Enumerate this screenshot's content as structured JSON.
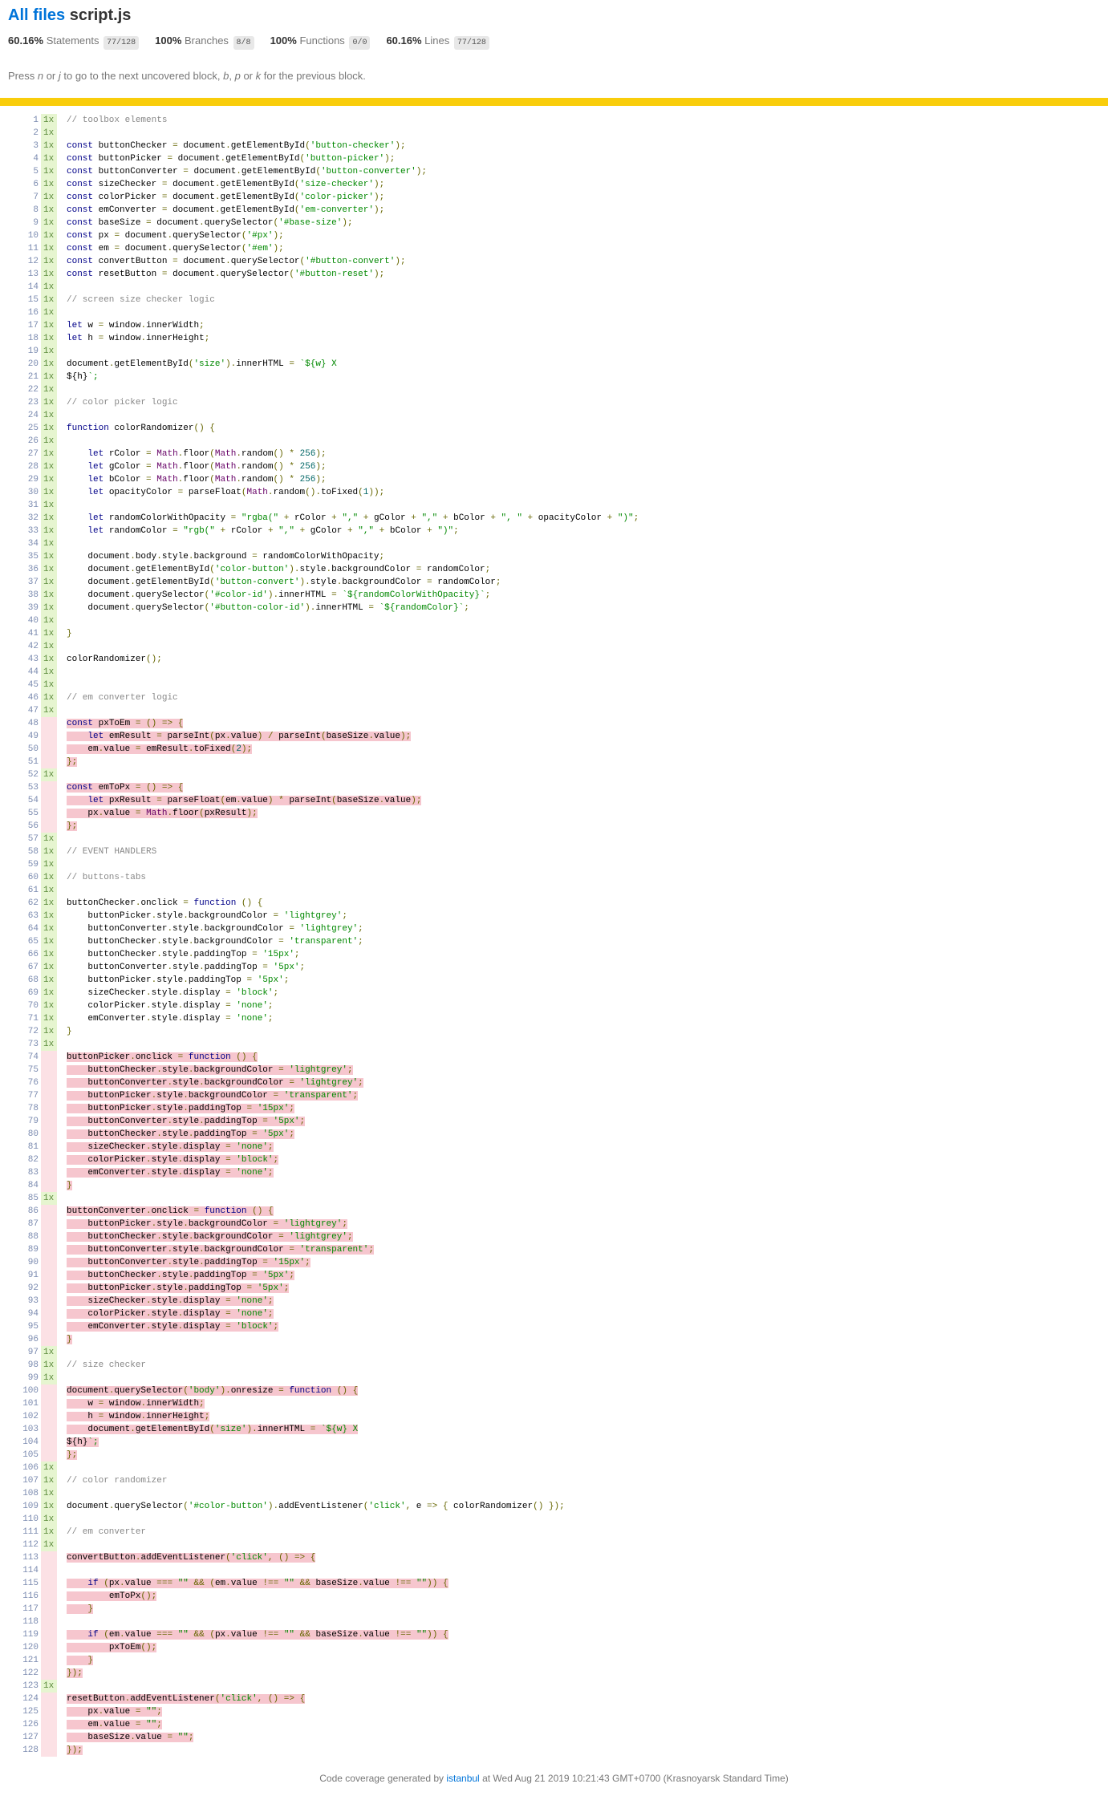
{
  "header": {
    "breadcrumb_link": "All files",
    "file_name": "script.js"
  },
  "summary": [
    {
      "pct": "60.16%",
      "label": "Statements",
      "fraction": "77/128"
    },
    {
      "pct": "100%",
      "label": "Branches",
      "fraction": "8/8"
    },
    {
      "pct": "100%",
      "label": "Functions",
      "fraction": "0/0"
    },
    {
      "pct": "60.16%",
      "label": "Lines",
      "fraction": "77/128"
    }
  ],
  "hint": {
    "p1": "Press ",
    "k1": "n",
    "p2": " or ",
    "k2": "j",
    "p3": " to go to the next uncovered block, ",
    "k3": "b",
    "p4": ", ",
    "k4": "p",
    "p5": " or ",
    "k5": "k",
    "p6": " for the previous block."
  },
  "status_color": "#F9CD0B",
  "colors": {
    "covered": "#E6F5D0",
    "uncovered_gutter": "#FCE1E5",
    "uncovered_code": "#F6C6CE",
    "link": "#0074D9"
  },
  "lines": [
    {
      "hits": "1x",
      "code": "// toolbox elements",
      "covered": true
    },
    {
      "hits": "1x",
      "code": "",
      "covered": true
    },
    {
      "hits": "1x",
      "code": "const buttonChecker = document.getElementById('button-checker');",
      "covered": true
    },
    {
      "hits": "1x",
      "code": "const buttonPicker = document.getElementById('button-picker');",
      "covered": true
    },
    {
      "hits": "1x",
      "code": "const buttonConverter = document.getElementById('button-converter');",
      "covered": true
    },
    {
      "hits": "1x",
      "code": "const sizeChecker = document.getElementById('size-checker');",
      "covered": true
    },
    {
      "hits": "1x",
      "code": "const colorPicker = document.getElementById('color-picker');",
      "covered": true
    },
    {
      "hits": "1x",
      "code": "const emConverter = document.getElementById('em-converter');",
      "covered": true
    },
    {
      "hits": "1x",
      "code": "const baseSize = document.querySelector('#base-size');",
      "covered": true
    },
    {
      "hits": "1x",
      "code": "const px = document.querySelector('#px');",
      "covered": true
    },
    {
      "hits": "1x",
      "code": "const em = document.querySelector('#em');",
      "covered": true
    },
    {
      "hits": "1x",
      "code": "const convertButton = document.querySelector('#button-convert');",
      "covered": true
    },
    {
      "hits": "1x",
      "code": "const resetButton = document.querySelector('#button-reset');",
      "covered": true
    },
    {
      "hits": "1x",
      "code": "",
      "covered": true
    },
    {
      "hits": "1x",
      "code": "// screen size checker logic",
      "covered": true
    },
    {
      "hits": "1x",
      "code": "",
      "covered": true
    },
    {
      "hits": "1x",
      "code": "let w = window.innerWidth;",
      "covered": true
    },
    {
      "hits": "1x",
      "code": "let h = window.innerHeight;",
      "covered": true
    },
    {
      "hits": "1x",
      "code": "",
      "covered": true
    },
    {
      "hits": "1x",
      "code": "document.getElementById('size').innerHTML = `${w} X",
      "covered": true
    },
    {
      "hits": "1x",
      "code": "${h}`;",
      "covered": true
    },
    {
      "hits": "1x",
      "code": "",
      "covered": true
    },
    {
      "hits": "1x",
      "code": "// color picker logic",
      "covered": true
    },
    {
      "hits": "1x",
      "code": "",
      "covered": true
    },
    {
      "hits": "1x",
      "code": "function colorRandomizer() {",
      "covered": true
    },
    {
      "hits": "1x",
      "code": "",
      "covered": true
    },
    {
      "hits": "1x",
      "code": "    let rColor = Math.floor(Math.random() * 256);",
      "covered": true
    },
    {
      "hits": "1x",
      "code": "    let gColor = Math.floor(Math.random() * 256);",
      "covered": true
    },
    {
      "hits": "1x",
      "code": "    let bColor = Math.floor(Math.random() * 256);",
      "covered": true
    },
    {
      "hits": "1x",
      "code": "    let opacityColor = parseFloat(Math.random().toFixed(1));",
      "covered": true
    },
    {
      "hits": "1x",
      "code": "",
      "covered": true
    },
    {
      "hits": "1x",
      "code": "    let randomColorWithOpacity = \"rgba(\" + rColor + \",\" + gColor + \",\" + bColor + \", \" + opacityColor + \")\";",
      "covered": true
    },
    {
      "hits": "1x",
      "code": "    let randomColor = \"rgb(\" + rColor + \",\" + gColor + \",\" + bColor + \")\";",
      "covered": true
    },
    {
      "hits": "1x",
      "code": "",
      "covered": true
    },
    {
      "hits": "1x",
      "code": "    document.body.style.background = randomColorWithOpacity;",
      "covered": true
    },
    {
      "hits": "1x",
      "code": "    document.getElementById('color-button').style.backgroundColor = randomColor;",
      "covered": true
    },
    {
      "hits": "1x",
      "code": "    document.getElementById('button-convert').style.backgroundColor = randomColor;",
      "covered": true
    },
    {
      "hits": "1x",
      "code": "    document.querySelector('#color-id').innerHTML = `${randomColorWithOpacity}`;",
      "covered": true
    },
    {
      "hits": "1x",
      "code": "    document.querySelector('#button-color-id').innerHTML = `${randomColor}`;",
      "covered": true
    },
    {
      "hits": "1x",
      "code": "",
      "covered": true
    },
    {
      "hits": "1x",
      "code": "}",
      "covered": true
    },
    {
      "hits": "1x",
      "code": "",
      "covered": true
    },
    {
      "hits": "1x",
      "code": "colorRandomizer();",
      "covered": true
    },
    {
      "hits": "1x",
      "code": "",
      "covered": true
    },
    {
      "hits": "1x",
      "code": "",
      "covered": true
    },
    {
      "hits": "1x",
      "code": "// em converter logic",
      "covered": true
    },
    {
      "hits": "1x",
      "code": "",
      "covered": true
    },
    {
      "hits": "",
      "code": "const pxToEm = () => {",
      "covered": false
    },
    {
      "hits": "",
      "code": "    let emResult = parseInt(px.value) / parseInt(baseSize.value);",
      "covered": false
    },
    {
      "hits": "",
      "code": "    em.value = emResult.toFixed(2);",
      "covered": false
    },
    {
      "hits": "",
      "code": "};",
      "covered": false
    },
    {
      "hits": "1x",
      "code": "",
      "covered": true
    },
    {
      "hits": "",
      "code": "const emToPx = () => {",
      "covered": false
    },
    {
      "hits": "",
      "code": "    let pxResult = parseFloat(em.value) * parseInt(baseSize.value);",
      "covered": false
    },
    {
      "hits": "",
      "code": "    px.value = Math.floor(pxResult);",
      "covered": false
    },
    {
      "hits": "",
      "code": "};",
      "covered": false
    },
    {
      "hits": "1x",
      "code": "",
      "covered": true
    },
    {
      "hits": "1x",
      "code": "// EVENT HANDLERS",
      "covered": true
    },
    {
      "hits": "1x",
      "code": "",
      "covered": true
    },
    {
      "hits": "1x",
      "code": "// buttons-tabs",
      "covered": true
    },
    {
      "hits": "1x",
      "code": "",
      "covered": true
    },
    {
      "hits": "1x",
      "code": "buttonChecker.onclick = function () {",
      "covered": true
    },
    {
      "hits": "1x",
      "code": "    buttonPicker.style.backgroundColor = 'lightgrey';",
      "covered": true
    },
    {
      "hits": "1x",
      "code": "    buttonConverter.style.backgroundColor = 'lightgrey';",
      "covered": true
    },
    {
      "hits": "1x",
      "code": "    buttonChecker.style.backgroundColor = 'transparent';",
      "covered": true
    },
    {
      "hits": "1x",
      "code": "    buttonChecker.style.paddingTop = '15px';",
      "covered": true
    },
    {
      "hits": "1x",
      "code": "    buttonConverter.style.paddingTop = '5px';",
      "covered": true
    },
    {
      "hits": "1x",
      "code": "    buttonPicker.style.paddingTop = '5px';",
      "covered": true
    },
    {
      "hits": "1x",
      "code": "    sizeChecker.style.display = 'block';",
      "covered": true
    },
    {
      "hits": "1x",
      "code": "    colorPicker.style.display = 'none';",
      "covered": true
    },
    {
      "hits": "1x",
      "code": "    emConverter.style.display = 'none';",
      "covered": true
    },
    {
      "hits": "1x",
      "code": "}",
      "covered": true
    },
    {
      "hits": "1x",
      "code": "",
      "covered": true
    },
    {
      "hits": "",
      "code": "buttonPicker.onclick = function () {",
      "covered": false
    },
    {
      "hits": "",
      "code": "    buttonChecker.style.backgroundColor = 'lightgrey';",
      "covered": false
    },
    {
      "hits": "",
      "code": "    buttonConverter.style.backgroundColor = 'lightgrey';",
      "covered": false
    },
    {
      "hits": "",
      "code": "    buttonPicker.style.backgroundColor = 'transparent';",
      "covered": false
    },
    {
      "hits": "",
      "code": "    buttonPicker.style.paddingTop = '15px';",
      "covered": false
    },
    {
      "hits": "",
      "code": "    buttonConverter.style.paddingTop = '5px';",
      "covered": false
    },
    {
      "hits": "",
      "code": "    buttonChecker.style.paddingTop = '5px';",
      "covered": false
    },
    {
      "hits": "",
      "code": "    sizeChecker.style.display = 'none';",
      "covered": false
    },
    {
      "hits": "",
      "code": "    colorPicker.style.display = 'block';",
      "covered": false
    },
    {
      "hits": "",
      "code": "    emConverter.style.display = 'none';",
      "covered": false
    },
    {
      "hits": "",
      "code": "}",
      "covered": false
    },
    {
      "hits": "1x",
      "code": "",
      "covered": true
    },
    {
      "hits": "",
      "code": "buttonConverter.onclick = function () {",
      "covered": false
    },
    {
      "hits": "",
      "code": "    buttonPicker.style.backgroundColor = 'lightgrey';",
      "covered": false
    },
    {
      "hits": "",
      "code": "    buttonChecker.style.backgroundColor = 'lightgrey';",
      "covered": false
    },
    {
      "hits": "",
      "code": "    buttonConverter.style.backgroundColor = 'transparent';",
      "covered": false
    },
    {
      "hits": "",
      "code": "    buttonConverter.style.paddingTop = '15px';",
      "covered": false
    },
    {
      "hits": "",
      "code": "    buttonChecker.style.paddingTop = '5px';",
      "covered": false
    },
    {
      "hits": "",
      "code": "    buttonPicker.style.paddingTop = '5px';",
      "covered": false
    },
    {
      "hits": "",
      "code": "    sizeChecker.style.display = 'none';",
      "covered": false
    },
    {
      "hits": "",
      "code": "    colorPicker.style.display = 'none';",
      "covered": false
    },
    {
      "hits": "",
      "code": "    emConverter.style.display = 'block';",
      "covered": false
    },
    {
      "hits": "",
      "code": "}",
      "covered": false
    },
    {
      "hits": "1x",
      "code": "",
      "covered": true
    },
    {
      "hits": "1x",
      "code": "// size checker",
      "covered": true
    },
    {
      "hits": "1x",
      "code": "",
      "covered": true
    },
    {
      "hits": "",
      "code": "document.querySelector('body').onresize = function () {",
      "covered": false
    },
    {
      "hits": "",
      "code": "    w = window.innerWidth;",
      "covered": false
    },
    {
      "hits": "",
      "code": "    h = window.innerHeight;",
      "covered": false
    },
    {
      "hits": "",
      "code": "    document.getElementById('size').innerHTML = `${w} X",
      "covered": false
    },
    {
      "hits": "",
      "code": "${h}`;",
      "covered": false
    },
    {
      "hits": "",
      "code": "};",
      "covered": false
    },
    {
      "hits": "1x",
      "code": "",
      "covered": true
    },
    {
      "hits": "1x",
      "code": "// color randomizer",
      "covered": true
    },
    {
      "hits": "1x",
      "code": "",
      "covered": true
    },
    {
      "hits": "1x",
      "code": "document.querySelector('#color-button').addEventListener('click', e => { colorRandomizer() });",
      "covered": true
    },
    {
      "hits": "1x",
      "code": "",
      "covered": true
    },
    {
      "hits": "1x",
      "code": "// em converter",
      "covered": true
    },
    {
      "hits": "1x",
      "code": "",
      "covered": true
    },
    {
      "hits": "",
      "code": "convertButton.addEventListener('click', () => {",
      "covered": false
    },
    {
      "hits": "",
      "code": "",
      "covered": false
    },
    {
      "hits": "",
      "code": "    if (px.value === \"\" && (em.value !== \"\" && baseSize.value !== \"\")) {",
      "covered": false
    },
    {
      "hits": "",
      "code": "        emToPx();",
      "covered": false
    },
    {
      "hits": "",
      "code": "    }",
      "covered": false
    },
    {
      "hits": "",
      "code": "",
      "covered": false
    },
    {
      "hits": "",
      "code": "    if (em.value === \"\" && (px.value !== \"\" && baseSize.value !== \"\")) {",
      "covered": false
    },
    {
      "hits": "",
      "code": "        pxToEm();",
      "covered": false
    },
    {
      "hits": "",
      "code": "    }",
      "covered": false
    },
    {
      "hits": "",
      "code": "});",
      "covered": false
    },
    {
      "hits": "1x",
      "code": "",
      "covered": true
    },
    {
      "hits": "",
      "code": "resetButton.addEventListener('click', () => {",
      "covered": false
    },
    {
      "hits": "",
      "code": "    px.value = \"\";",
      "covered": false
    },
    {
      "hits": "",
      "code": "    em.value = \"\";",
      "covered": false
    },
    {
      "hits": "",
      "code": "    baseSize.value = \"\";",
      "covered": false
    },
    {
      "hits": "",
      "code": "});",
      "covered": false
    }
  ],
  "footer": {
    "prefix": "Code coverage generated by ",
    "link": "istanbul",
    "suffix": " at Wed Aug 21 2019 10:21:43 GMT+0700 (Krasnoyarsk Standard Time)"
  }
}
